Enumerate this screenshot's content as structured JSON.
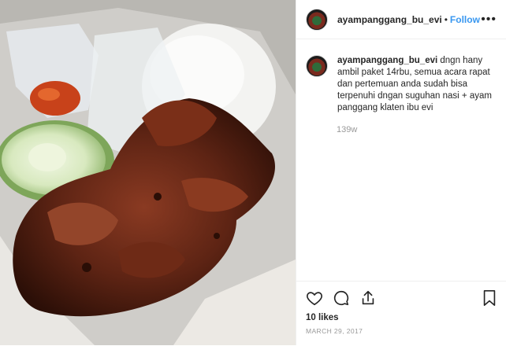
{
  "post": {
    "username": "ayampanggang_bu_evi",
    "separator": "•",
    "follow_label": "Follow",
    "more_label": "•••"
  },
  "comment": {
    "username": "ayampanggang_bu_evi",
    "text": "dngn hany ambil paket 14rbu, semua acara rapat dan pertemuan anda sudah bisa terpenuhi dngan suguhan nasi + ayam panggang klaten ibu evi",
    "time": "139w"
  },
  "stats": {
    "likes": "10 likes",
    "date": "MARCH 29, 2017"
  },
  "icons": {
    "like": "heart-icon",
    "comment": "comment-icon",
    "share": "share-icon",
    "save": "bookmark-icon"
  }
}
